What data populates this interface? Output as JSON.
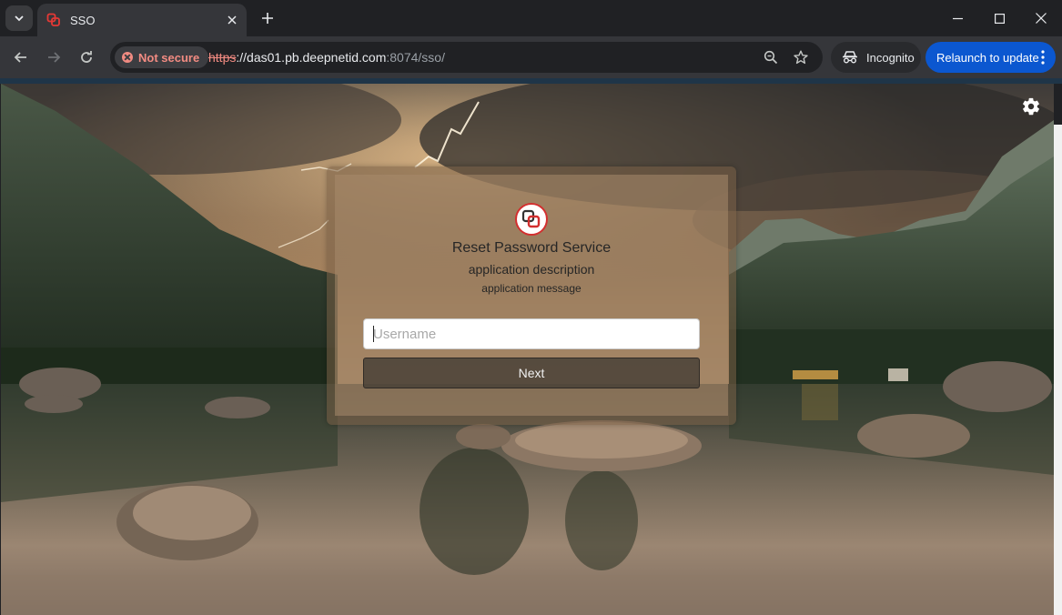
{
  "browser": {
    "tab": {
      "title": "SSO"
    },
    "address": {
      "security_label": "Not secure",
      "url_scheme": "https",
      "url_host": "://das01.pb.deepnetid.com",
      "url_rest": ":8074/sso/"
    },
    "incognito_label": "Incognito",
    "relaunch_label": "Relaunch to update"
  },
  "page": {
    "title": "Reset Password Service",
    "description": "application description",
    "message": "application message",
    "username_placeholder": "Username",
    "next_label": "Next"
  },
  "colors": {
    "omnibox_bg": "#202124",
    "toolbar_bg": "#35363a",
    "relaunch_blue": "#0b57d0",
    "not_secure_red": "#f28b82",
    "logo_red": "#d32f2f"
  }
}
